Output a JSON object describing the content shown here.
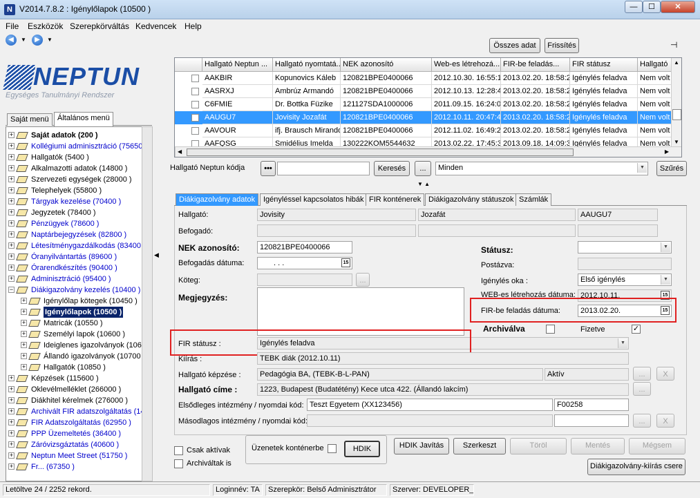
{
  "window": {
    "title": "V2014.7.8.2 : Igénylőlapok (10500 )",
    "app_icon": "N",
    "min": "—",
    "max": "☐",
    "close": "✕"
  },
  "menu": [
    "File",
    "Eszközök",
    "Szerepkörváltás",
    "Kedvencek",
    "Help"
  ],
  "logo": {
    "name": "NEPTUN",
    "subtitle": "Egységes Tanulmányi Rendszer"
  },
  "left_tabs": [
    "Saját menü",
    "Általános menü"
  ],
  "tree": [
    {
      "label": "Saját adatok (200 )",
      "style": "bold",
      "indent": 0
    },
    {
      "label": "Kollégiumi adminisztráció (75650",
      "style": "blue",
      "indent": 0
    },
    {
      "label": "Hallgatók (5400 )",
      "style": "",
      "indent": 0
    },
    {
      "label": "Alkalmazotti adatok (14800 )",
      "style": "",
      "indent": 0
    },
    {
      "label": "Szervezeti egységek (28000 )",
      "style": "",
      "indent": 0
    },
    {
      "label": "Telephelyek (55800 )",
      "style": "",
      "indent": 0
    },
    {
      "label": "Tárgyak kezelése (70400 )",
      "style": "blue",
      "indent": 0
    },
    {
      "label": "Jegyzetek (78400 )",
      "style": "",
      "indent": 0
    },
    {
      "label": "Pénzügyek (78600 )",
      "style": "blue",
      "indent": 0
    },
    {
      "label": "Naptárbejegyzések (82800 )",
      "style": "blue",
      "indent": 0
    },
    {
      "label": "Létesítménygazdálkodás (83400",
      "style": "blue",
      "indent": 0
    },
    {
      "label": "Óranyilvántartás (89600 )",
      "style": "blue",
      "indent": 0
    },
    {
      "label": "Órarendkészítés (90400 )",
      "style": "blue",
      "indent": 0
    },
    {
      "label": "Adminisztráció (95400 )",
      "style": "blue",
      "indent": 0
    },
    {
      "label": "Diákigazolvány kezelés (10400 )",
      "style": "blue",
      "indent": 0,
      "open": true
    },
    {
      "label": "Igénylőlap kötegek (10450 )",
      "style": "",
      "indent": 1
    },
    {
      "label": "Igénylőlapok (10500 )",
      "style": "sel",
      "indent": 1
    },
    {
      "label": "Matricák (10550 )",
      "style": "",
      "indent": 1
    },
    {
      "label": "Személyi lapok (10600 )",
      "style": "",
      "indent": 1
    },
    {
      "label": "Ideiglenes igazolványok (1065",
      "style": "",
      "indent": 1
    },
    {
      "label": "Állandó igazolványok (10700",
      "style": "",
      "indent": 1
    },
    {
      "label": "Hallgatók (10850 )",
      "style": "",
      "indent": 1
    },
    {
      "label": "Képzések (115600 )",
      "style": "",
      "indent": 0
    },
    {
      "label": "Oklevélmelléklet (266000 )",
      "style": "",
      "indent": 0
    },
    {
      "label": "Diákhitel kérelmek (276000 )",
      "style": "",
      "indent": 0
    },
    {
      "label": "Archivált FIR adatszolgáltatás (14",
      "style": "blue",
      "indent": 0
    },
    {
      "label": "FIR Adatszolgáltatás (62950 )",
      "style": "blue",
      "indent": 0
    },
    {
      "label": "PPP Üzemeltetés (36400 )",
      "style": "blue",
      "indent": 0
    },
    {
      "label": "Záróvizsgáztatás (40600 )",
      "style": "blue",
      "indent": 0
    },
    {
      "label": "Neptun Meet Street (51750 )",
      "style": "blue",
      "indent": 0
    },
    {
      "label": "Fr... (67350 )",
      "style": "blue",
      "indent": 0
    }
  ],
  "top_buttons": {
    "osszes": "Összes adat",
    "frissites": "Frissítés"
  },
  "grid": {
    "columns": [
      "Hallgató Neptun ...",
      "Hallgató nyomtatá...",
      "NEK azonosító",
      "Web-es létrehozá...",
      "FIR-be feladás...",
      "FIR státusz",
      "Hallgató"
    ],
    "rows": [
      [
        "AAKBIR",
        "Kopunovics Káleb",
        "120821BPE0400066",
        "2012.10.30. 16:55:1",
        "2013.02.20. 18:58:2",
        "Igénylés feladva",
        "Nem volt"
      ],
      [
        "AASRXJ",
        "Ambrúz Armandó",
        "120821BPE0400066",
        "2012.10.13. 12:28:4",
        "2013.02.20. 18:58:2",
        "Igénylés feladva",
        "Nem volt"
      ],
      [
        "C6FMIE",
        "Dr. Bottka Füzike",
        "121127SDA1000006",
        "2011.09.15. 16:24:0",
        "2013.02.20. 18:58:2",
        "Igénylés feladva",
        "Nem volt"
      ],
      [
        "AAUGU7",
        "Jovisity Jozafát",
        "120821BPE0400066",
        "2012.10.11. 20:47:4",
        "2013.02.20. 18:58:2",
        "Igénylés feladva",
        "Nem volt"
      ],
      [
        "AAVOUR",
        "ifj. Brausch Mirandol",
        "120821BPE0400066",
        "2012.11.02. 16:49:2",
        "2013.02.20. 18:58:2",
        "Igénylés feladva",
        "Nem volt"
      ],
      [
        "AAFQSG",
        "Smidélius Imelda",
        "130222KOM5544632",
        "2013.02.22. 17:45:3",
        "2013.09.18. 14:09:3",
        "Igénylés feladva",
        "Nem volt"
      ]
    ],
    "selected_row": 3
  },
  "search": {
    "label": "Hallgató Neptun kódja",
    "dots": "•••",
    "value": "",
    "search_btn": "Keresés",
    "ellipsis_btn": "...",
    "filter": "Minden",
    "filter_btn": "Szűrés"
  },
  "tabs": [
    "Diákigazolvány adatok",
    "Igényléssel kapcsolatos hibák",
    "FIR konténerek",
    "Diákigazolvány státuszok",
    "Számlák"
  ],
  "form": {
    "hallgato_label": "Hallgató:",
    "hallgato_last": "Jovisity",
    "hallgato_first": "Jozafát",
    "hallgato_code": "AAUGU7",
    "befogado_label": "Befogadó:",
    "nek_label": "NEK azonosító:",
    "nek_value": "120821BPE0400066",
    "befogadas_label": "Befogadás dátuma:",
    "befogadas_value": ". . .",
    "koteg_label": "Köteg:",
    "koteg_btn": "...",
    "megjegyzes_label": "Megjegyzés:",
    "statusz_label": "Státusz:",
    "statusz_value": "",
    "postazva_label": "Postázva:",
    "igenyles_oka_label": "Igénylés oka :",
    "igenyles_oka_value": "Első igénylés",
    "web_label": "WEB-es létrehozás dátuma:",
    "web_value": "2012.10.11.",
    "fir_feladas_label": "FIR-be feladás dátuma:",
    "fir_feladas_value": "2013.02.20.",
    "archivalva_label": "Archiválva",
    "archivalva_checked": "",
    "fizetve_label": "Fizetve",
    "fizetve_checked": "✓",
    "fir_statusz_label": "FIR státusz :",
    "fir_statusz_value": "Igénylés feladva",
    "kiiras_label": "Kiírás :",
    "kiiras_value": "TEBK diák (2012.10.11)",
    "kepzes_label": "Hallgató képzése :",
    "kepzes_value": "Pedagógia BA, (TEBK-B-L-PAN)",
    "kepzes_status": "Aktív",
    "kepzes_btn": "...",
    "kepzes_x": "X",
    "cim_label": "Hallgató címe :",
    "cim_value": "1223, Budapest (Budatétény) Kece utca 422. (Állandó lakcím)",
    "cim_btn": "...",
    "elso_label": "Elsődleges intézmény / nyomdai kód:",
    "elso_value": "Teszt Egyetem (XX123456)",
    "elso_code": "F00258",
    "masod_label": "Másodlagos intézmény / nyomdai kód:",
    "masod_btn": "...",
    "masod_x": "X"
  },
  "bottom": {
    "csak_aktivak": "Csak aktívak",
    "archivaltak": "Archiváltak is",
    "uzenetek": "Üzenetek konténerbe",
    "hdik": "HDIK",
    "hdik_javitas": "HDIK Javítás",
    "szerkeszt": "Szerkeszt",
    "torol": "Töröl",
    "mentes": "Mentés",
    "megsem": "Mégsem",
    "csere": "Diákigazolvány-kiírás csere"
  },
  "status": {
    "records": "Letöltve 24 / 2252 rekord.",
    "login": "Loginnév: TA",
    "role": "Szerepkör: Belső Adminisztrátor",
    "server": "Szerver: DEVELOPER_Te"
  },
  "colors": {
    "selection": "#3399ff",
    "tree_selection": "#0a246a",
    "link_blue": "#0000cc",
    "highlight_red": "#e02020",
    "logo_blue": "#1b4ea6"
  }
}
